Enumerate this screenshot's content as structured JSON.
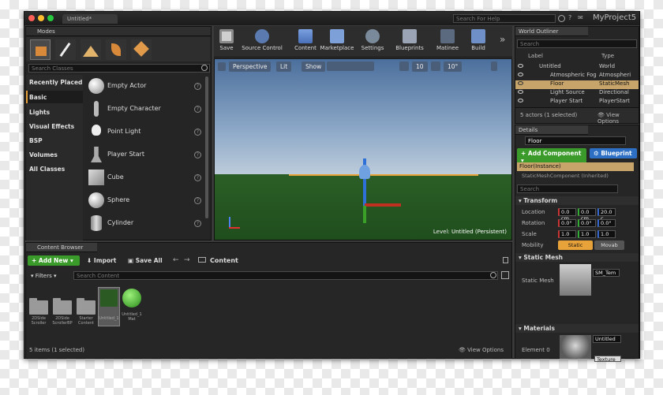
{
  "window": {
    "tab": "Untitled*",
    "search_placeholder": "Search For Help",
    "project": "MyProject5"
  },
  "modes": {
    "title": "Modes",
    "search_placeholder": "Search Classes",
    "categories": [
      "Recently Placed",
      "Basic",
      "Lights",
      "Visual Effects",
      "BSP",
      "Volumes",
      "All Classes"
    ],
    "items": [
      "Empty Actor",
      "Empty Character",
      "Point Light",
      "Player Start",
      "Cube",
      "Sphere",
      "Cylinder"
    ]
  },
  "toolbar": {
    "items": [
      "Save",
      "Source Control",
      "Content",
      "Marketplace",
      "Settings",
      "Blueprints",
      "Matinee",
      "Build"
    ]
  },
  "viewport": {
    "perspective": "Perspective",
    "lit": "Lit",
    "show": "Show",
    "grid": "10",
    "angle": "10°",
    "level_label": "Level:",
    "level_name": "Untitled (Persistent)"
  },
  "outliner": {
    "title": "World Outliner",
    "search_placeholder": "Search",
    "col_label": "Label",
    "col_type": "Type",
    "rows": [
      {
        "label": "Untitled",
        "type": "World"
      },
      {
        "label": "Atmospheric Fog",
        "type": "Atmospheri"
      },
      {
        "label": "Floor",
        "type": "StaticMesh"
      },
      {
        "label": "Light Source",
        "type": "Directional"
      },
      {
        "label": "Player Start",
        "type": "PlayerStart"
      }
    ],
    "status": "5 actors (1 selected)",
    "view_options": "View Options"
  },
  "details": {
    "title": "Details",
    "name": "Floor",
    "add_component": "Add Component",
    "blueprint": "Blueprint",
    "components": [
      "Floor(Instance)",
      "StaticMeshComponent (Inherited)"
    ],
    "search_placeholder": "Search",
    "transform": "Transform",
    "location": "Location",
    "rotation": "Rotation",
    "scale": "Scale",
    "mobility": "Mobility",
    "loc": [
      "0.0 cm",
      "0.0 cm",
      "20.0 c"
    ],
    "rot": [
      "0.0°",
      "0.0°",
      "0.0°"
    ],
    "scl": [
      "1.0",
      "1.0",
      "1.0"
    ],
    "static": "Static",
    "movable": "Movab",
    "static_mesh_section": "Static Mesh",
    "static_mesh_label": "Static Mesh",
    "static_mesh_value": "SM_Tem",
    "materials": "Materials",
    "element": "Element 0",
    "material_value": "Untitled",
    "texture": "Texture"
  },
  "content": {
    "title": "Content Browser",
    "add_new": "Add New",
    "import": "Import",
    "save_all": "Save All",
    "path": "Content",
    "filters": "Filters",
    "search_placeholder": "Search Content",
    "assets": [
      {
        "name": "2DSide Scroller"
      },
      {
        "name": "2DSide ScrollerBP"
      },
      {
        "name": "Starter Content"
      },
      {
        "name": "Untitled_1"
      },
      {
        "name": "Untitled_1 Mat"
      }
    ],
    "status": "5 items (1 selected)",
    "view_options": "View Options"
  },
  "colors": {
    "accent": "#e8a23a",
    "green": "#3a9a2a",
    "selected": "#c6a46a"
  }
}
